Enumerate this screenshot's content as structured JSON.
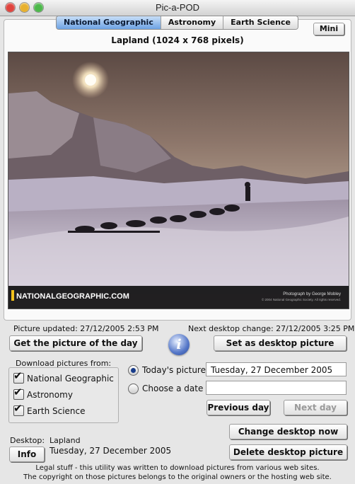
{
  "window": {
    "title": "Pic-a-POD"
  },
  "tabs": [
    {
      "label": "National Geographic",
      "active": true
    },
    {
      "label": "Astronomy",
      "active": false
    },
    {
      "label": "Earth Science",
      "active": false
    }
  ],
  "mini_button": "Mini",
  "picture": {
    "title": "Lapland (1024 x 768 pixels)",
    "logo_text": "NATIONALGEOGRAPHIC.COM",
    "credit": "Photograph by George Mobley",
    "copyright": "© 2004 National Geographic Society. All rights reserved."
  },
  "status": {
    "updated": "Picture updated: 27/12/2005 2:53 PM",
    "next_change": "Next desktop change: 27/12/2005 3:25 PM"
  },
  "buttons": {
    "get_picture": "Get the picture of the day",
    "set_desktop": "Set as desktop picture",
    "previous_day": "Previous day",
    "next_day": "Next day",
    "change_desktop": "Change desktop now",
    "delete_desktop": "Delete desktop picture",
    "info": "Info"
  },
  "download": {
    "heading": "Download pictures from:",
    "sources": [
      {
        "label": "National Geographic",
        "checked": true
      },
      {
        "label": "Astronomy",
        "checked": true
      },
      {
        "label": "Earth Science",
        "checked": true
      }
    ]
  },
  "date_choice": {
    "today_label": "Today's picture",
    "today_value": "Tuesday, 27 December 2005",
    "choose_label": "Choose a date",
    "choose_value": "",
    "selected": "today"
  },
  "desktop": {
    "label": "Desktop:",
    "name": "Lapland",
    "date": "Tuesday, 27 December 2005"
  },
  "legal": {
    "line1": "Legal stuff - this utility was written to download pictures from various web sites.",
    "line2": "The copyright on those pictures belongs to the original owners or the hosting web site."
  },
  "colors": {
    "active_tab": "#6ea3e4",
    "close_light": "#e0443e",
    "minimize_light": "#e8b12e",
    "zoom_light": "#4cb84a"
  }
}
